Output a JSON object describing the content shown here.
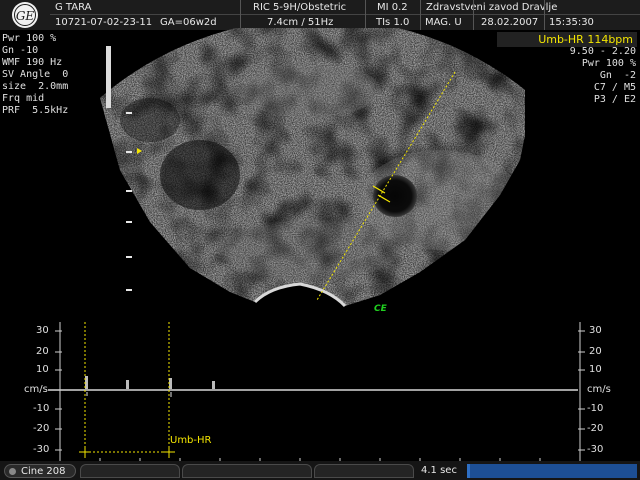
{
  "header": {
    "patient_name": "G TARA",
    "exam_id": "10721-07-02-23-11",
    "gestational_age": "GA=06w2d",
    "probe": "RIC 5-9H/Obstetric",
    "depth_freq": "7.4cm / 51Hz",
    "mi": "MI  0.2",
    "tis": "TIs  1.0",
    "institution": "Zdravstveni zavod Dravlje",
    "mag": "MAG. U",
    "date": "28.02.2007",
    "time": "15:35:30"
  },
  "left_params": [
    "Pwr 100 %",
    "Gn -10",
    "WMF 190 Hz",
    "SV Angle  0",
    "size  2.0mm",
    "Frq mid",
    "PRF  5.5kHz"
  ],
  "right_badge": "Umb-HR 114bpm",
  "right_params": [
    "9.50 - 2.20",
    "Pwr 100 %",
    "Gn  -2",
    "C7 / M5",
    "P3 / E2"
  ],
  "marker_ce": "CE",
  "doppler": {
    "unit": "cm/s",
    "scale_labels": [
      "30",
      "20",
      "10",
      "cm/s",
      "-10",
      "-20",
      "-30"
    ],
    "annotation": "Umb-HR",
    "heart_rate_bpm": 114
  },
  "footer": {
    "cine_label": "Cine 208",
    "sweep_label": "4.1 sec",
    "progress_fraction": 0.02
  },
  "colors": {
    "annotation_yellow": "#f4e600",
    "marker_green": "#20d020",
    "progress_blue": "#1d4f95",
    "header_bg": "#1c1c1c"
  }
}
